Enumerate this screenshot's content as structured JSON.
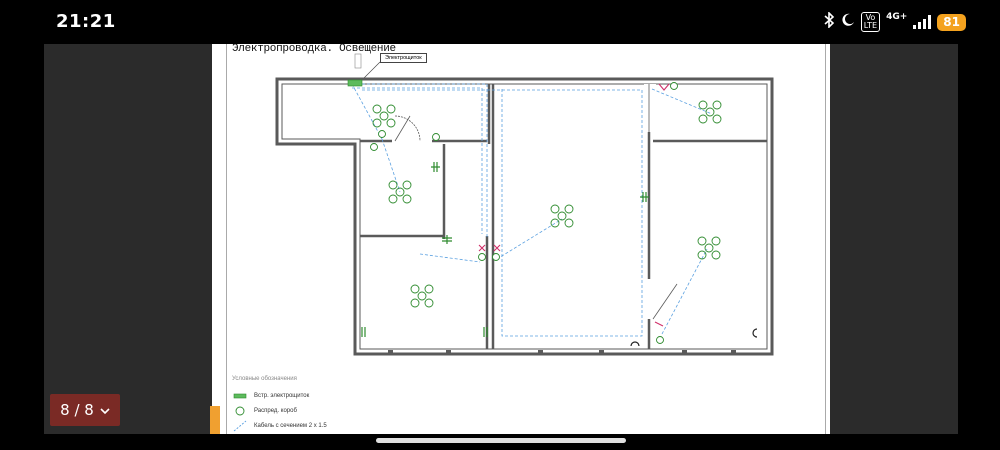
{
  "statusbar": {
    "time": "21:21",
    "volte_label": "Vo\nLTE",
    "network": "4G+",
    "battery": "81",
    "icons": [
      "bluetooth-icon",
      "moon-icon",
      "volte-icon",
      "signal-icon",
      "battery-icon"
    ]
  },
  "document": {
    "title": "Электропроводка. Освещение",
    "callout": "Электрощиток",
    "legend": {
      "title": "Условные обозначения",
      "items": [
        {
          "icon": "panel-symbol",
          "label": "Встр. электрощиток"
        },
        {
          "icon": "junction-box-symbol",
          "label": "Распред. короб"
        },
        {
          "icon": "cable-symbol",
          "label": "Кабель с сечением 2 x 1.5"
        }
      ]
    }
  },
  "pager": {
    "label": "8 / 8",
    "icon": "chevron-down-icon"
  },
  "colors": {
    "wall": "#5a5a5a",
    "fixture": "#2e8b2e",
    "cable": "#5aa0e0",
    "switch": "#d0306a",
    "accent_tab": "#f0a030",
    "page_badge": "#7a2a25"
  }
}
